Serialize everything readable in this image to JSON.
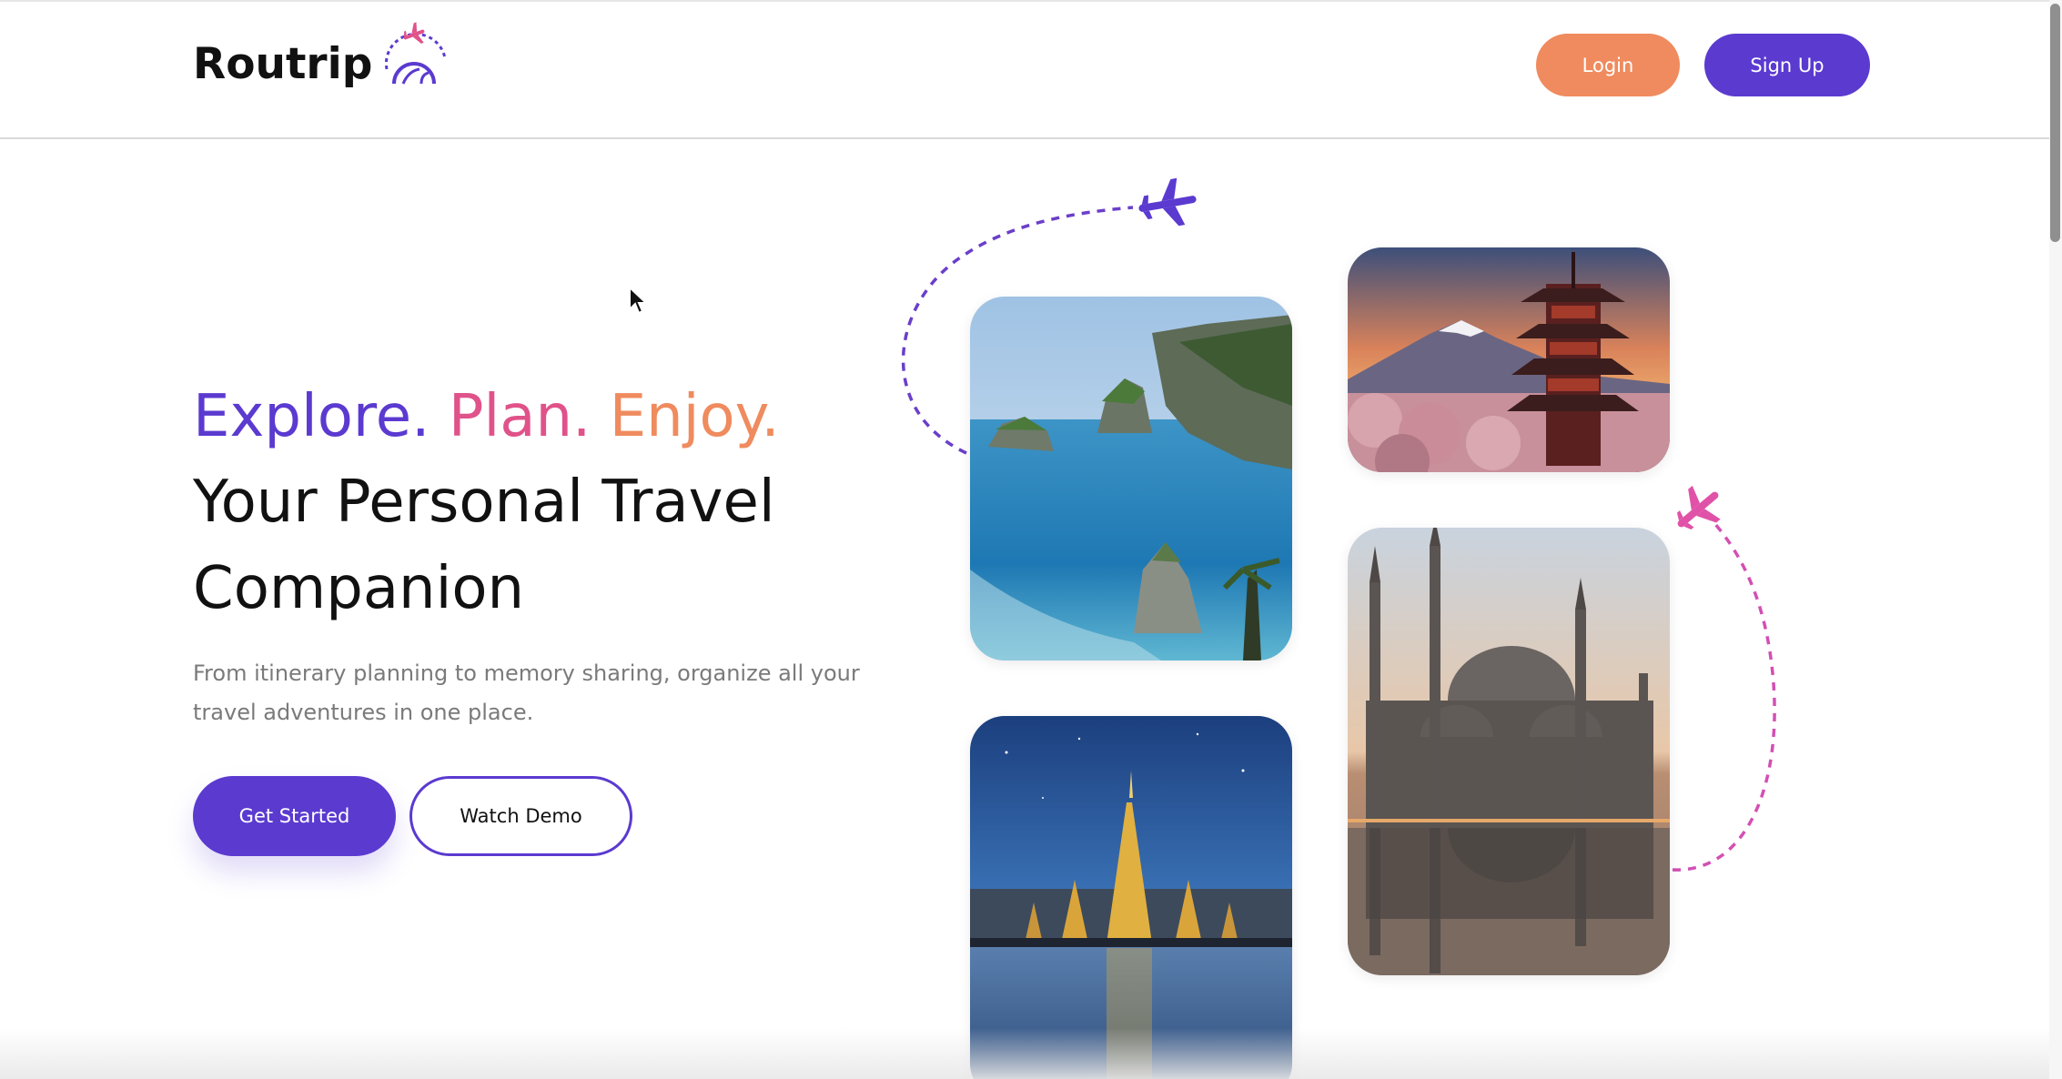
{
  "header": {
    "logo_text": "Routrip",
    "login_label": "Login",
    "signup_label": "Sign Up"
  },
  "hero": {
    "tagline": {
      "explore": "Explore.",
      "plan": "Plan.",
      "enjoy": "Enjoy."
    },
    "title_line1": "Your Personal Travel",
    "title_line2": "Companion",
    "description": "From itinerary planning to memory sharing, organize all your travel adventures in one place.",
    "get_started_label": "Get Started",
    "watch_demo_label": "Watch Demo"
  },
  "gallery": {
    "images": [
      {
        "name": "bali-coast-image",
        "icon": "coastal-cliffs"
      },
      {
        "name": "japan-pagoda-image",
        "icon": "pagoda-mountain"
      },
      {
        "name": "istanbul-mosque-image",
        "icon": "mosque-reflection"
      },
      {
        "name": "bangkok-temple-image",
        "icon": "temple-night"
      }
    ],
    "decor": [
      "plane-icon-purple",
      "plane-icon-pink",
      "dashed-flight-path"
    ]
  },
  "colors": {
    "brand_purple": "#5b3ad0",
    "brand_pink": "#e0528a",
    "brand_orange": "#ef8b5e",
    "text_dark": "#111111",
    "text_muted": "#7a7a7a"
  }
}
